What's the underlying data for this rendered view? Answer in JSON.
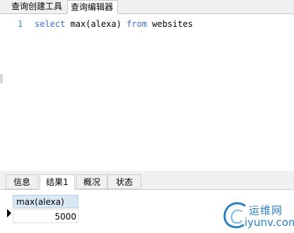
{
  "top_tabs": [
    "查询创建工具",
    "查询编辑器"
  ],
  "editor": {
    "line_number": "1",
    "tokens": [
      {
        "text": "select",
        "type": "keyword"
      },
      {
        "text": " max(alexa) ",
        "type": "plain"
      },
      {
        "text": "from",
        "type": "keyword"
      },
      {
        "text": " websites",
        "type": "plain"
      }
    ]
  },
  "bottom_tabs": [
    "信息",
    "结果1",
    "概况",
    "状态"
  ],
  "active_bottom_tab": "结果1",
  "result_grid": {
    "columns": [
      "max(alexa)"
    ],
    "rows": [
      [
        "5000"
      ]
    ]
  },
  "watermark": {
    "cn": "运维网",
    "en": "iyunv.com"
  },
  "colors": {
    "keyword": "#3c6bd6",
    "line_number": "#2b91af",
    "header_bg": "#d9e8f6",
    "watermark": "#2a7fc4"
  }
}
